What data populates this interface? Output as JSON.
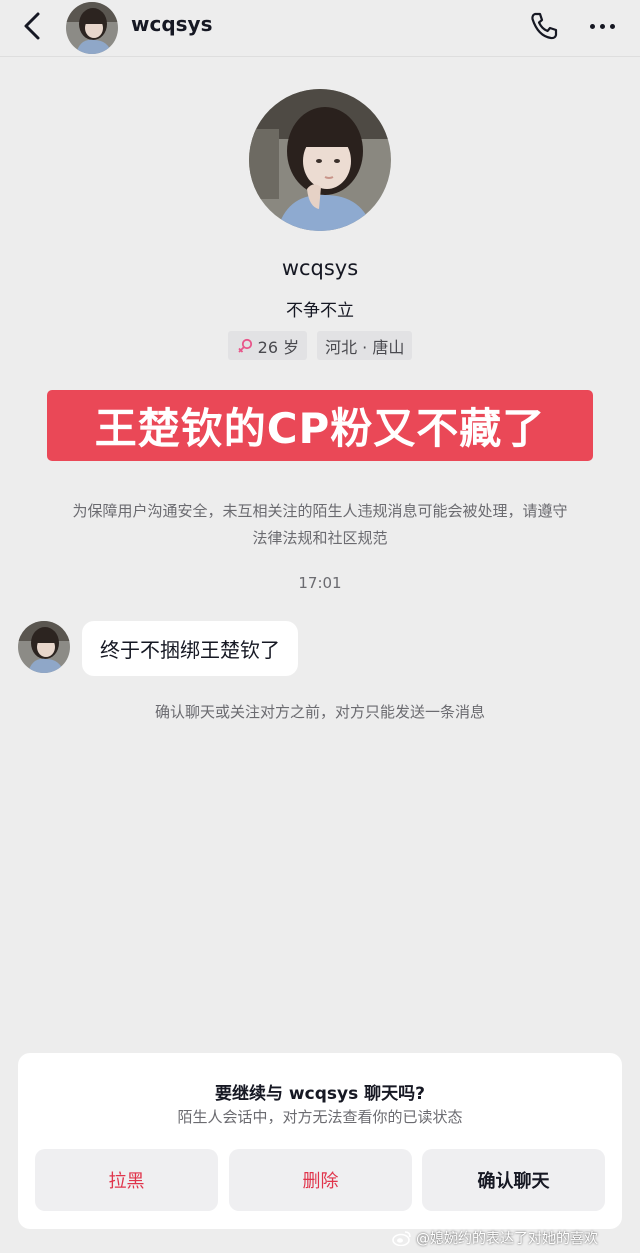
{
  "header": {
    "username": "wcqsys"
  },
  "profile": {
    "name": "wcqsys",
    "bio": "不争不立",
    "age_tag": "26 岁",
    "location_tag": "河北 · 唐山",
    "gender_icon": "female-icon"
  },
  "banner": {
    "text": "王楚钦的CP粉又不藏了"
  },
  "chat": {
    "safety_notice": "为保障用户沟通安全，未互相关注的陌生人违规消息可能会被处理，请遵守法律法规和社区规范",
    "timestamp": "17:01",
    "message": "终于不捆绑王楚钦了",
    "limit_notice": "确认聊天或关注对方之前，对方只能发送一条消息"
  },
  "sheet": {
    "title": "要继续与 wcqsys 聊天吗?",
    "subtitle": "陌生人会话中，对方无法查看你的已读状态",
    "block_label": "拉黑",
    "delete_label": "删除",
    "confirm_label": "确认聊天"
  },
  "watermark": {
    "text": "@媳婉约的表达了对她的喜欢"
  },
  "colors": {
    "banner": "#ea4857",
    "danger_text": "#e0344b",
    "background": "#ededed"
  }
}
